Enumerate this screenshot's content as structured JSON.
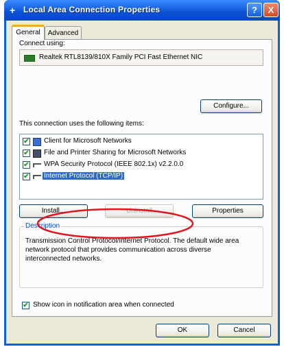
{
  "window": {
    "title": "Local Area Connection Properties",
    "help_glyph": "?",
    "close_glyph": "X"
  },
  "tabs": [
    {
      "label": "General"
    },
    {
      "label": "Advanced"
    }
  ],
  "general": {
    "connect_using_label": "Connect using:",
    "adapter_name": "Realtek RTL8139/810X Family PCI Fast Ethernet NIC",
    "configure_button": "Configure...",
    "items_label": "This connection uses the following items:",
    "items": [
      {
        "label": "Client for Microsoft Networks",
        "checked": true,
        "selected": false,
        "icon": "client-icon"
      },
      {
        "label": "File and Printer Sharing for Microsoft Networks",
        "checked": true,
        "selected": false,
        "icon": "printer-icon"
      },
      {
        "label": "WPA Security Protocol (IEEE 802.1x) v2.2.0.0",
        "checked": true,
        "selected": false,
        "icon": "protocol-icon"
      },
      {
        "label": "Internet Protocol (TCP/IP)",
        "checked": true,
        "selected": true,
        "icon": "protocol-icon"
      }
    ],
    "install_button": "Install...",
    "uninstall_button": "Uninstall",
    "properties_button": "Properties",
    "description_title": "Description",
    "description_text": "Transmission Control Protocol/Internet Protocol. The default wide area network protocol that provides communication across diverse interconnected networks.",
    "show_icon_label": "Show icon in notification area when connected",
    "show_icon_checked": true
  },
  "footer": {
    "ok_button": "OK",
    "cancel_button": "Cancel"
  },
  "colors": {
    "titlebar": "#0a52d6",
    "selection": "#316ac5",
    "annotation": "#e0141c",
    "tab_highlight": "#f5a623"
  },
  "check_glyph": "✔"
}
